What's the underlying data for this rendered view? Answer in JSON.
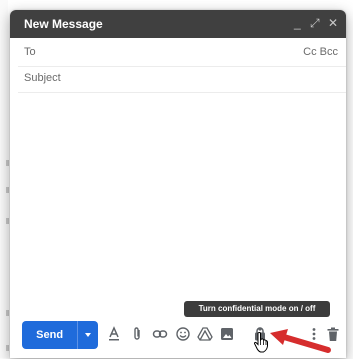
{
  "compose": {
    "title": "New Message",
    "to_label": "To",
    "cc_bcc": "Cc Bcc",
    "subject_placeholder": "Subject"
  },
  "header_controls": {
    "minimize": "_",
    "expand": "⤢",
    "close": "✕"
  },
  "toolbar": {
    "send_label": "Send",
    "tooltip": "Turn confidential mode on / off"
  },
  "colors": {
    "header_bg": "#404040",
    "send_blue": "#1f6bdb",
    "arrow_red": "#d62d2d",
    "icon_gray": "#5f6368"
  }
}
